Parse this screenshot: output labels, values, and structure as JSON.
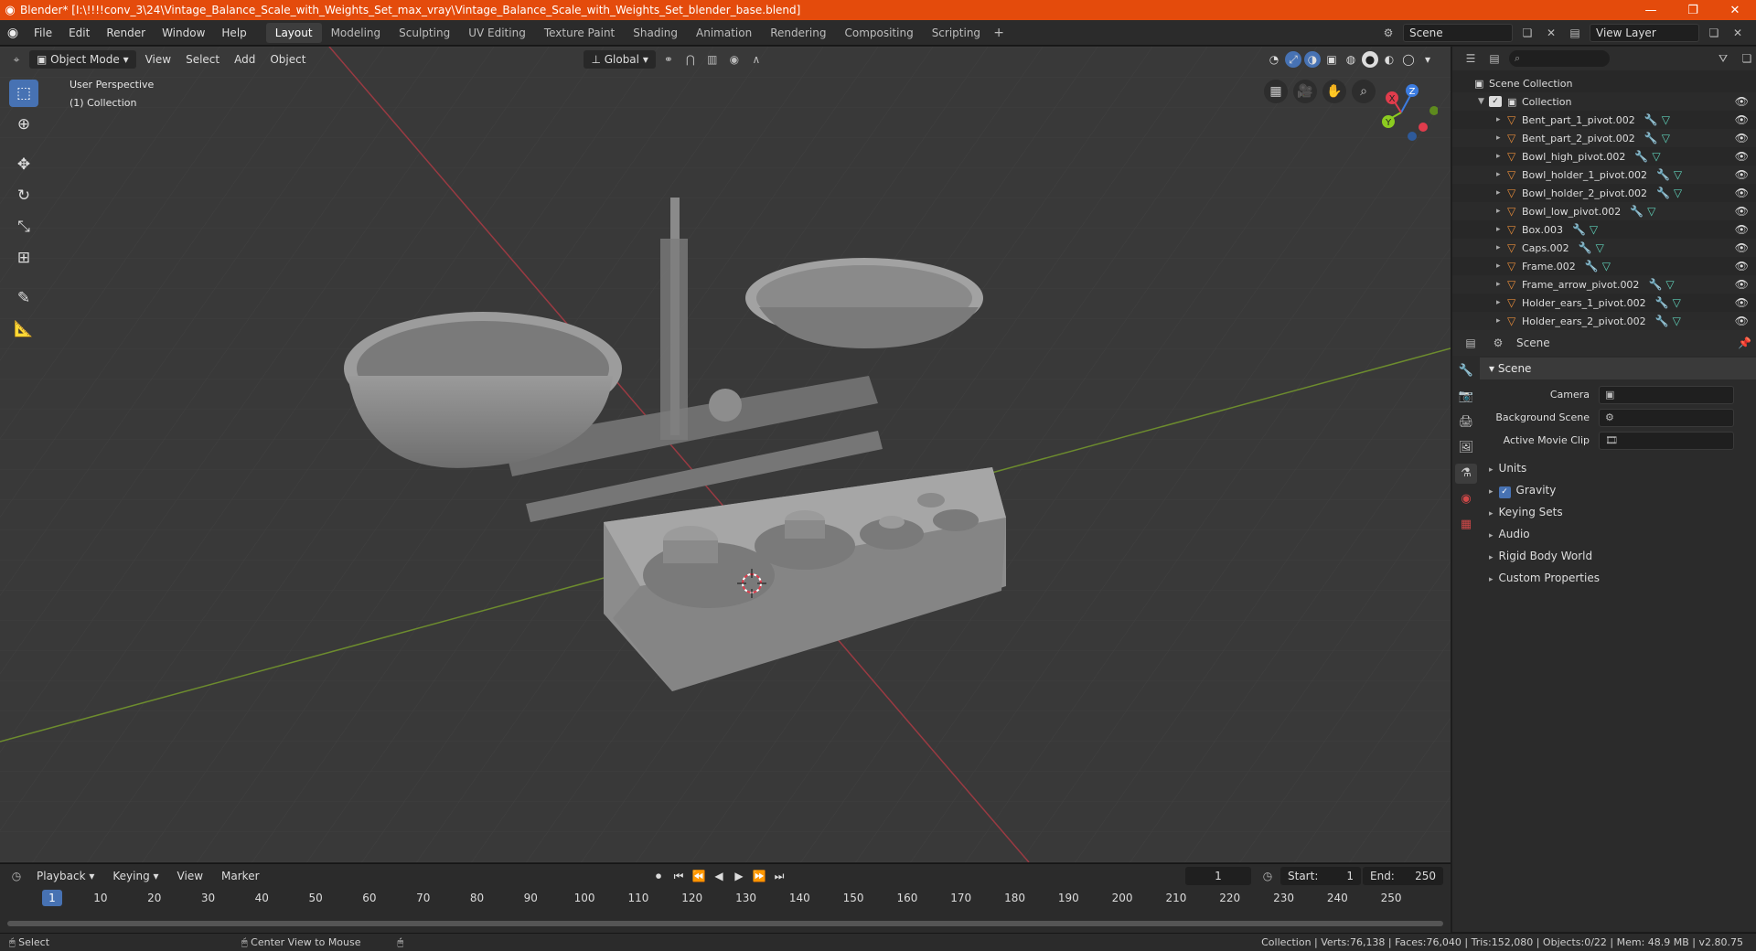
{
  "titlebar": {
    "title": "Blender* [I:\\!!!!conv_3\\24\\Vintage_Balance_Scale_with_Weights_Set_max_vray\\Vintage_Balance_Scale_with_Weights_Set_blender_base.blend]"
  },
  "menubar": {
    "items": [
      "File",
      "Edit",
      "Render",
      "Window",
      "Help"
    ],
    "workspaces": [
      "Layout",
      "Modeling",
      "Sculpting",
      "UV Editing",
      "Texture Paint",
      "Shading",
      "Animation",
      "Rendering",
      "Compositing",
      "Scripting"
    ],
    "active_workspace": "Layout",
    "scene_name": "Scene",
    "view_layer": "View Layer"
  },
  "viewport": {
    "mode": "Object Mode",
    "menus": [
      "View",
      "Select",
      "Add",
      "Object"
    ],
    "transform_orientation": "Global",
    "info_line1": "User Perspective",
    "info_line2": "(1) Collection",
    "gizmo": {
      "x": "X",
      "y": "Y",
      "z": "Z"
    }
  },
  "outliner": {
    "root": "Scene Collection",
    "collection": "Collection",
    "objects": [
      "Bent_part_1_pivot.002",
      "Bent_part_2_pivot.002",
      "Bowl_high_pivot.002",
      "Bowl_holder_1_pivot.002",
      "Bowl_holder_2_pivot.002",
      "Bowl_low_pivot.002",
      "Box.003",
      "Caps.002",
      "Frame.002",
      "Frame_arrow_pivot.002",
      "Holder_ears_1_pivot.002",
      "Holder_ears_2_pivot.002"
    ]
  },
  "properties": {
    "context": "Scene",
    "panel_title": "Scene",
    "fields": [
      {
        "label": "Camera",
        "value": ""
      },
      {
        "label": "Background Scene",
        "value": ""
      },
      {
        "label": "Active Movie Clip",
        "value": ""
      }
    ],
    "subpanels": [
      "Units",
      "Gravity",
      "Keying Sets",
      "Audio",
      "Rigid Body World",
      "Custom Properties"
    ]
  },
  "timeline": {
    "menus": [
      "Playback",
      "Keying",
      "View",
      "Marker"
    ],
    "current_frame": "1",
    "start_label": "Start:",
    "start": "1",
    "end_label": "End:",
    "end": "250",
    "ticks": [
      "1",
      "10",
      "20",
      "30",
      "40",
      "50",
      "60",
      "70",
      "80",
      "90",
      "100",
      "110",
      "120",
      "130",
      "140",
      "150",
      "160",
      "170",
      "180",
      "190",
      "200",
      "210",
      "220",
      "230",
      "240",
      "250"
    ]
  },
  "statusbar": {
    "select": "Select",
    "center": "Center View to Mouse",
    "stats": "Collection | Verts:76,138 | Faces:76,040 | Tris:152,080 | Objects:0/22 | Mem: 48.9 MB | v2.80.75"
  },
  "colors": {
    "titlebar": "#e44b0c",
    "accent": "#4772b3",
    "object_icon": "#e58b3a",
    "axis_x": "#e03c4c",
    "axis_y": "#8ccc20",
    "axis_z": "#3c7ce0"
  }
}
